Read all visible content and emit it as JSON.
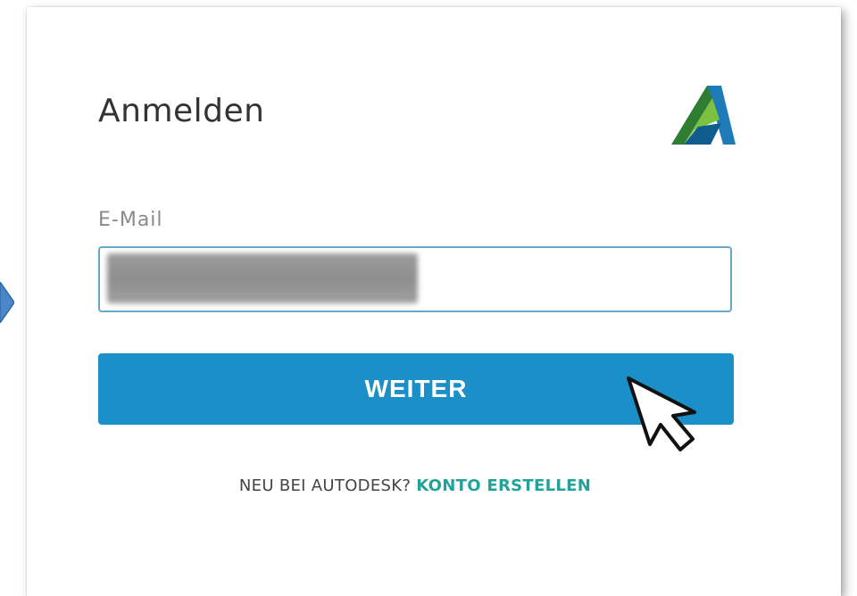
{
  "signin": {
    "title": "Anmelden",
    "email_label": "E-Mail",
    "email_value": "",
    "continue_label": "WEITER",
    "signup_prompt": "NEU BEI AUTODESK?",
    "signup_link": "KONTO ERSTELLEN"
  },
  "icons": {
    "brand_logo": "autodesk-logo-icon",
    "cursor": "mouse-pointer-icon",
    "side_marker": "arrow-right-icon"
  },
  "colors": {
    "primary_button": "#1b8fc8",
    "input_border": "#6aa6c8",
    "link": "#21a399",
    "title_text": "#333333",
    "label_text": "#8a8a8a",
    "logo_green": "#4caf50",
    "logo_blue": "#1f7ab8"
  }
}
